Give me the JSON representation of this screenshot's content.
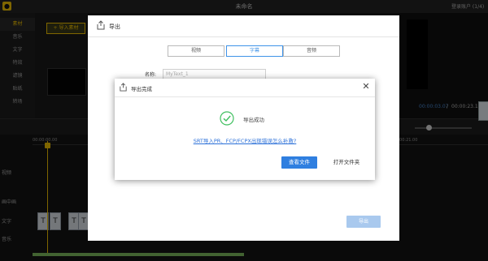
{
  "app": {
    "window_title": "未命名",
    "title_right": "登录账户 (1/4)"
  },
  "left_nav": {
    "items": [
      "素材",
      "音乐",
      "文字",
      "特效",
      "滤镜",
      "贴纸",
      "转场"
    ]
  },
  "media_panel": {
    "import_button": "+ 导入素材"
  },
  "preview": {
    "current_time": "00:00:03.07",
    "separator": "/",
    "total_time": "00:00:23.10"
  },
  "timeline": {
    "ruler_start": "00:00:00.00",
    "ruler_end": "00:00:21.00",
    "tracks": [
      "视频",
      "画中画",
      "文字",
      "音乐"
    ],
    "clip_glyph": "T"
  },
  "export_window": {
    "title": "导出",
    "tabs": [
      "视频",
      "字幕",
      "音频"
    ],
    "active_tab": 1,
    "name_label": "名称:",
    "name_value": "MyText_1",
    "export_button": "导出"
  },
  "dialog": {
    "title": "导出完成",
    "success_text": "导出成功",
    "help_link": "SRT导入PR、FCP/FCPX出现错误怎么补救?",
    "view_button": "查看文件",
    "open_folder_button": "打开文件夹",
    "colors": {
      "primary": "#2f7fe0",
      "success": "#3fbf5f",
      "link": "#2a6fd8"
    }
  }
}
